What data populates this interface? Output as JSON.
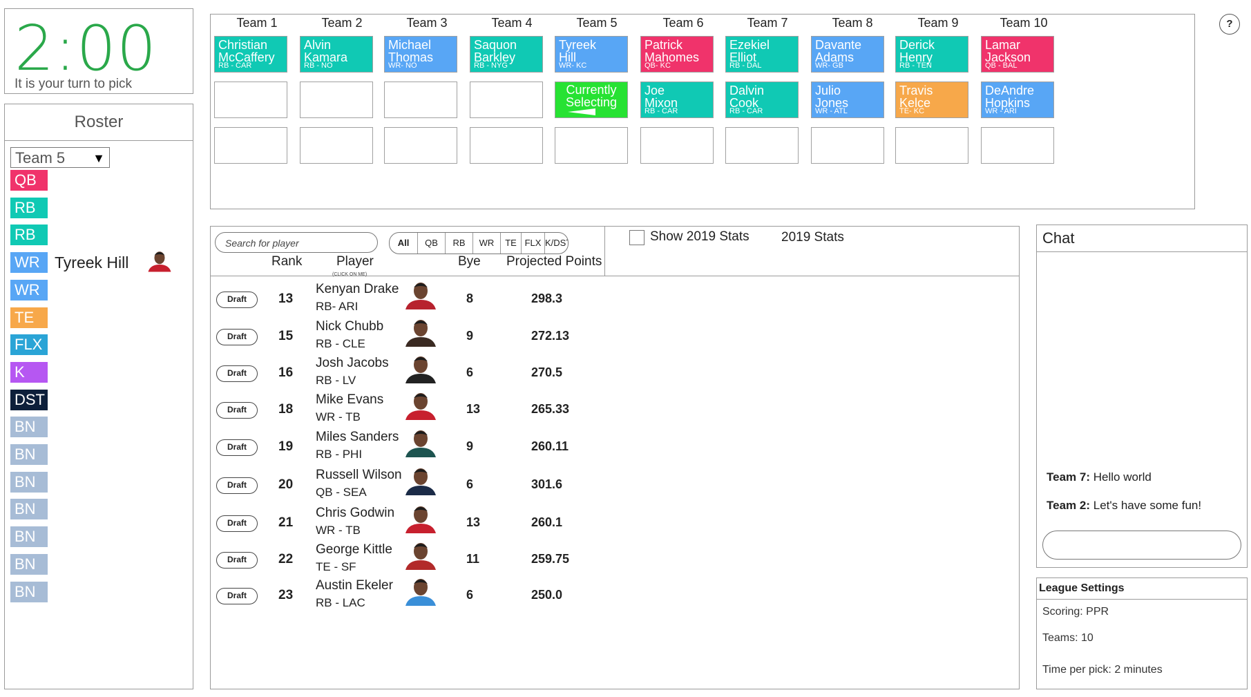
{
  "timer": {
    "time": "2:00",
    "message": "It is your turn to pick"
  },
  "roster": {
    "title": "Roster",
    "selected_team": "Team 5",
    "slots": [
      {
        "pos": "QB",
        "color": "#f0336b",
        "player": ""
      },
      {
        "pos": "RB",
        "color": "#10c9b4",
        "player": ""
      },
      {
        "pos": "RB",
        "color": "#10c9b4",
        "player": ""
      },
      {
        "pos": "WR",
        "color": "#58a6f5",
        "player": "Tyreek Hill"
      },
      {
        "pos": "WR",
        "color": "#58a6f5",
        "player": ""
      },
      {
        "pos": "TE",
        "color": "#f7a84a",
        "player": ""
      },
      {
        "pos": "FLX",
        "color": "#2aa4d6",
        "player": ""
      },
      {
        "pos": "K",
        "color": "#b657f2",
        "player": ""
      },
      {
        "pos": "DST",
        "color": "#0d1f3a",
        "player": ""
      },
      {
        "pos": "BN",
        "color": "#a7bcd6",
        "player": ""
      },
      {
        "pos": "BN",
        "color": "#a7bcd6",
        "player": ""
      },
      {
        "pos": "BN",
        "color": "#a7bcd6",
        "player": ""
      },
      {
        "pos": "BN",
        "color": "#a7bcd6",
        "player": ""
      },
      {
        "pos": "BN",
        "color": "#a7bcd6",
        "player": ""
      },
      {
        "pos": "BN",
        "color": "#a7bcd6",
        "player": ""
      },
      {
        "pos": "BN",
        "color": "#a7bcd6",
        "player": ""
      }
    ]
  },
  "board": {
    "teams": [
      "Team 1",
      "Team 2",
      "Team 3",
      "Team 4",
      "Team 5",
      "Team 6",
      "Team 7",
      "Team 8",
      "Team 9",
      "Team 10"
    ],
    "round1": [
      {
        "first": "Christian",
        "last": "McCaffery",
        "pos": "RB - CAR",
        "color": "#10c9b4"
      },
      {
        "first": "Alvin",
        "last": "Kamara",
        "pos": "RB - NO",
        "color": "#10c9b4"
      },
      {
        "first": "Michael",
        "last": "Thomas",
        "pos": "WR- NO",
        "color": "#58a6f5"
      },
      {
        "first": "Saquon",
        "last": "Barkley",
        "pos": "RB - NYG",
        "color": "#10c9b4"
      },
      {
        "first": "Tyreek",
        "last": "Hill",
        "pos": "WR- KC",
        "color": "#58a6f5"
      },
      {
        "first": "Patrick",
        "last": "Mahomes",
        "pos": "QB- KC",
        "color": "#f0336b"
      },
      {
        "first": "Ezekiel",
        "last": "Elliot",
        "pos": "RB - DAL",
        "color": "#10c9b4"
      },
      {
        "first": "Davante",
        "last": "Adams",
        "pos": "WR- GB",
        "color": "#58a6f5"
      },
      {
        "first": "Derick",
        "last": "Henry",
        "pos": "RB - TEN",
        "color": "#10c9b4"
      },
      {
        "first": "Lamar",
        "last": "Jackson",
        "pos": "QB - BAL",
        "color": "#f0336b"
      }
    ],
    "round2": [
      null,
      null,
      null,
      null,
      {
        "current": true,
        "line1": "Currently",
        "line2": "Selecting",
        "color": "#27e233"
      },
      {
        "first": "Joe",
        "last": "Mixon",
        "pos": "RB - CAR",
        "color": "#10c9b4"
      },
      {
        "first": "Dalvin",
        "last": "Cook",
        "pos": "RB - CAR",
        "color": "#10c9b4"
      },
      {
        "first": "Julio",
        "last": "Jones",
        "pos": "WR - ATL",
        "color": "#58a6f5"
      },
      {
        "first": "Travis",
        "last": "Kelce",
        "pos": "TE- KC",
        "color": "#f7a84a"
      },
      {
        "first": "DeAndre",
        "last": "Hopkins",
        "pos": "WR - ARI",
        "color": "#58a6f5"
      }
    ],
    "help": "?"
  },
  "players": {
    "search_placeholder": "Search for player",
    "filters": [
      "All",
      "QB",
      "RB",
      "WR",
      "TE",
      "FLX",
      "K/DST"
    ],
    "show_stats_label": "Show 2019 Stats",
    "stats_label": "2019 Stats",
    "headers": {
      "rank": "Rank",
      "player": "Player",
      "bye": "Bye",
      "points": "Projected Points"
    },
    "click_hint": "(CLICK ON ME)",
    "draft_label": "Draft",
    "rows": [
      {
        "rank": "13",
        "name": "Kenyan Drake",
        "pos": "RB- ARI",
        "bye": "8",
        "points": "298.3",
        "color": "#b7222e"
      },
      {
        "rank": "15",
        "name": "Nick Chubb",
        "pos": "RB - CLE",
        "bye": "9",
        "points": "272.13",
        "color": "#3a2a22"
      },
      {
        "rank": "16",
        "name": "Josh Jacobs",
        "pos": "RB - LV",
        "bye": "6",
        "points": "270.5",
        "color": "#222222"
      },
      {
        "rank": "18",
        "name": "Mike Evans",
        "pos": "WR - TB",
        "bye": "13",
        "points": "265.33",
        "color": "#c7202e"
      },
      {
        "rank": "19",
        "name": "Miles Sanders",
        "pos": "RB - PHI",
        "bye": "9",
        "points": "260.11",
        "color": "#1d5450"
      },
      {
        "rank": "20",
        "name": "Russell Wilson",
        "pos": "QB - SEA",
        "bye": "6",
        "points": "301.6",
        "color": "#1b2b47"
      },
      {
        "rank": "21",
        "name": "Chris Godwin",
        "pos": "WR - TB",
        "bye": "13",
        "points": "260.1",
        "color": "#c7202e"
      },
      {
        "rank": "22",
        "name": "George Kittle",
        "pos": "TE - SF",
        "bye": "11",
        "points": "259.75",
        "color": "#b22a2a"
      },
      {
        "rank": "23",
        "name": "Austin Ekeler",
        "pos": "RB - LAC",
        "bye": "6",
        "points": "250.0",
        "color": "#3a8fd8"
      }
    ]
  },
  "chat": {
    "title": "Chat",
    "messages": [
      {
        "team": "Team 7:",
        "text": "Hello world"
      },
      {
        "team": "Team 2:",
        "text": "Let's have some fun!"
      }
    ]
  },
  "league": {
    "title": "League Settings",
    "scoring": "Scoring: PPR",
    "teams": "Teams: 10",
    "time_per_pick": "Time per pick: 2 minutes"
  }
}
